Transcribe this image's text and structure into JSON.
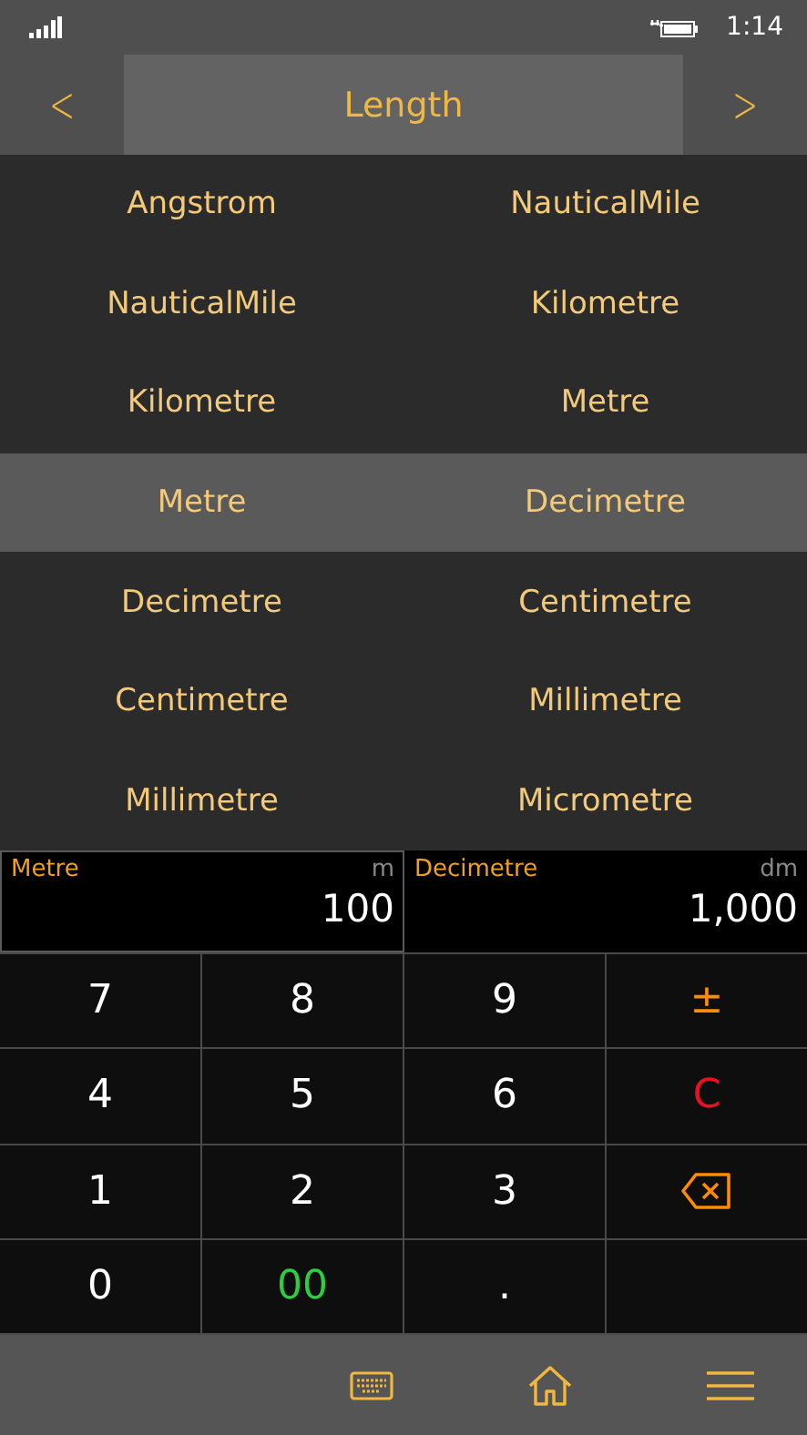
{
  "status_bar": {
    "time": "1:14"
  },
  "header": {
    "title": "Length",
    "prev": "<",
    "next": ">"
  },
  "from_units": [
    {
      "label": "Angstrom",
      "selected": false
    },
    {
      "label": "NauticalMile",
      "selected": false
    },
    {
      "label": "Kilometre",
      "selected": false
    },
    {
      "label": "Metre",
      "selected": true
    },
    {
      "label": "Decimetre",
      "selected": false
    },
    {
      "label": "Centimetre",
      "selected": false
    },
    {
      "label": "Millimetre",
      "selected": false
    }
  ],
  "to_units": [
    {
      "label": "NauticalMile",
      "selected": false
    },
    {
      "label": "Kilometre",
      "selected": false
    },
    {
      "label": "Metre",
      "selected": false
    },
    {
      "label": "Decimetre",
      "selected": true
    },
    {
      "label": "Centimetre",
      "selected": false
    },
    {
      "label": "Millimetre",
      "selected": false
    },
    {
      "label": "Micrometre",
      "selected": false
    }
  ],
  "displays": [
    {
      "unit": "Metre",
      "symbol": "m",
      "value": "100",
      "selected": true
    },
    {
      "unit": "Decimetre",
      "symbol": "dm",
      "value": "1,000",
      "selected": false
    }
  ],
  "keypad": [
    {
      "kind": "digit",
      "label": "7"
    },
    {
      "kind": "digit",
      "label": "8"
    },
    {
      "kind": "digit",
      "label": "9"
    },
    {
      "kind": "sign",
      "label": "±"
    },
    {
      "kind": "digit",
      "label": "4"
    },
    {
      "kind": "digit",
      "label": "5"
    },
    {
      "kind": "digit",
      "label": "6"
    },
    {
      "kind": "clear",
      "label": "C"
    },
    {
      "kind": "digit",
      "label": "1"
    },
    {
      "kind": "digit",
      "label": "2"
    },
    {
      "kind": "digit",
      "label": "3"
    },
    {
      "kind": "backspace"
    },
    {
      "kind": "digit",
      "label": "0"
    },
    {
      "kind": "double",
      "label": "00"
    },
    {
      "kind": "digit",
      "label": "."
    },
    {
      "kind": "blank"
    }
  ]
}
